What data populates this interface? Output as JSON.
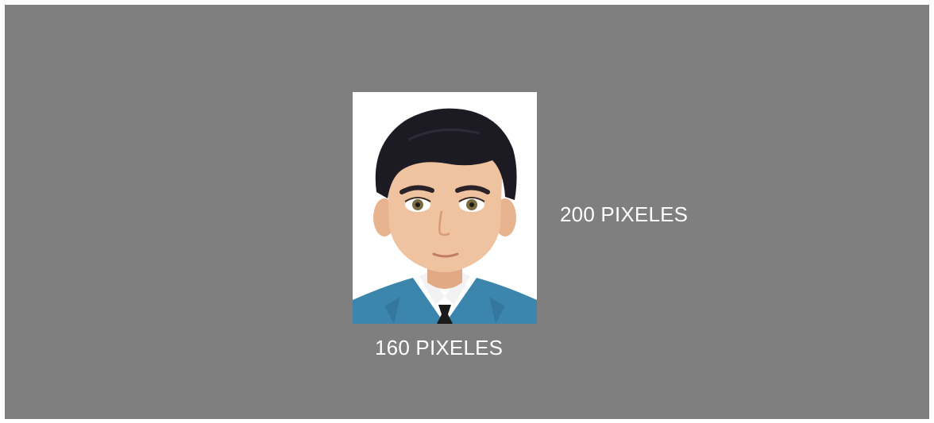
{
  "labels": {
    "height": "200 PIXELES",
    "width": "160 PIXELES"
  },
  "avatar": {
    "icon": "cartoon-man-portrait",
    "colors": {
      "background": "#7f7f7f",
      "photo_background": "#ffffff",
      "hair": "#1c1a22",
      "skin": "#efc3a0",
      "suit": "#3c86ad",
      "tie": "#1a1a1a",
      "label_text": "#ffffff"
    }
  }
}
